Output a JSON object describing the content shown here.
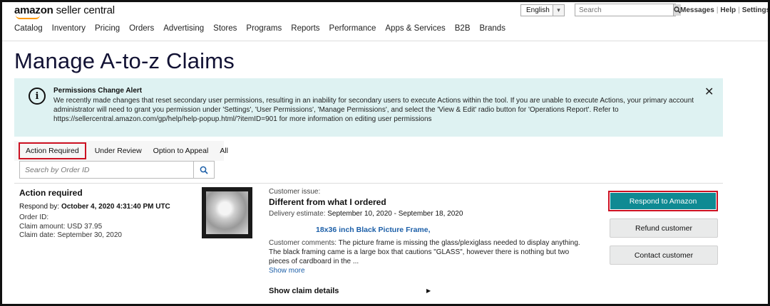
{
  "header": {
    "logo_bold": "amazon",
    "logo_light": "seller central",
    "language": "English",
    "search_placeholder": "Search",
    "links": [
      "Messages",
      "Help",
      "Settings"
    ]
  },
  "nav": [
    "Catalog",
    "Inventory",
    "Pricing",
    "Orders",
    "Advertising",
    "Stores",
    "Programs",
    "Reports",
    "Performance",
    "Apps & Services",
    "B2B",
    "Brands"
  ],
  "page_title": "Manage A-to-z Claims",
  "alert": {
    "icon": "info-icon",
    "title": "Permissions Change Alert",
    "body": "We recently made changes that reset secondary user permissions, resulting in an inability for secondary users to execute Actions within the tool. If you are unable to execute Actions, your primary account administrator will need to grant you permission under 'Settings', 'User Permissions', 'Manage Permissions', and select the 'View & Edit' radio button for 'Operations Report'. Refer to https://sellercentral.amazon.com/gp/help/help-popup.html/?itemID=901 for more information on editing user permissions",
    "close": "✕"
  },
  "tabs": [
    "Action Required",
    "Under Review",
    "Option to Appeal",
    "All"
  ],
  "order_search_placeholder": "Search by Order ID",
  "claim": {
    "status": "Action required",
    "respond_by_label": "Respond by:",
    "respond_by_value": "October 4, 2020 4:31:40 PM UTC",
    "order_id": "Order ID:",
    "claim_amount": "Claim amount: USD 37.95",
    "claim_date": "Claim date: September 30, 2020",
    "issue_label": "Customer issue:",
    "issue": "Different from what I ordered",
    "delivery_label": "Delivery estimate:",
    "delivery_value": "September 10, 2020 - September 18, 2020",
    "product": "18x36 inch Black Picture Frame,",
    "comments_label": "Customer comments:",
    "comments": "The picture frame is missing the glass/plexiglass needed to display anything. The black framing came is a large box that cautions \"GLASS\", however there is nothing but two pieces of cardboard in the ...",
    "show_more": "Show more",
    "show_details": "Show claim details"
  },
  "actions": {
    "respond": "Respond to Amazon",
    "refund": "Refund customer",
    "contact": "Contact customer"
  },
  "colors": {
    "primary_button": "#0f8a93",
    "highlight_outline": "#cc1122",
    "alert_bg": "#def2f2",
    "link": "#1c5fa8"
  }
}
